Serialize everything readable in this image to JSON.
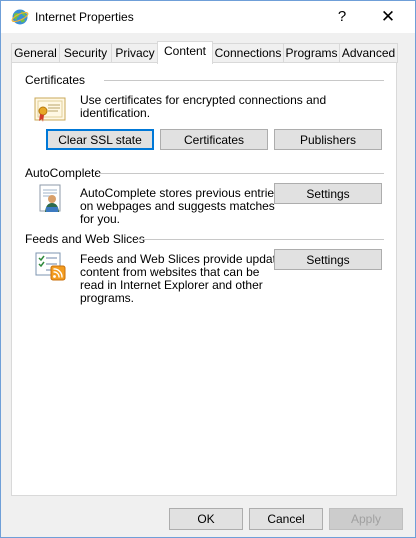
{
  "window": {
    "title": "Internet Properties",
    "help_glyph": "?",
    "close_glyph": "✕"
  },
  "tabs": [
    {
      "label": "General"
    },
    {
      "label": "Security"
    },
    {
      "label": "Privacy"
    },
    {
      "label": "Content",
      "selected": true
    },
    {
      "label": "Connections"
    },
    {
      "label": "Programs"
    },
    {
      "label": "Advanced"
    }
  ],
  "certificates": {
    "heading": "Certificates",
    "description": "Use certificates for encrypted connections and identification.",
    "clear_ssl_label": "Clear SSL state",
    "certificates_label": "Certificates",
    "publishers_label": "Publishers",
    "icon": "certificate-icon"
  },
  "autocomplete": {
    "heading": "AutoComplete",
    "description_lines": [
      "AutoComplete stores previous entries",
      "on webpages and suggests matches",
      "for you."
    ],
    "settings_label": "Settings",
    "icon": "autocomplete-user-icon"
  },
  "feeds": {
    "heading": "Feeds and Web Slices",
    "description_lines": [
      "Feeds and Web Slices provide updated",
      "content from websites that can be",
      "read in Internet Explorer and other",
      "programs."
    ],
    "settings_label": "Settings",
    "icon": "feeds-rss-icon"
  },
  "footer": {
    "ok_label": "OK",
    "cancel_label": "Cancel",
    "apply_label": "Apply"
  },
  "colors": {
    "focus_blue": "#0078d7",
    "button_face": "#e1e1e1",
    "window_border": "#6f9fd8"
  }
}
